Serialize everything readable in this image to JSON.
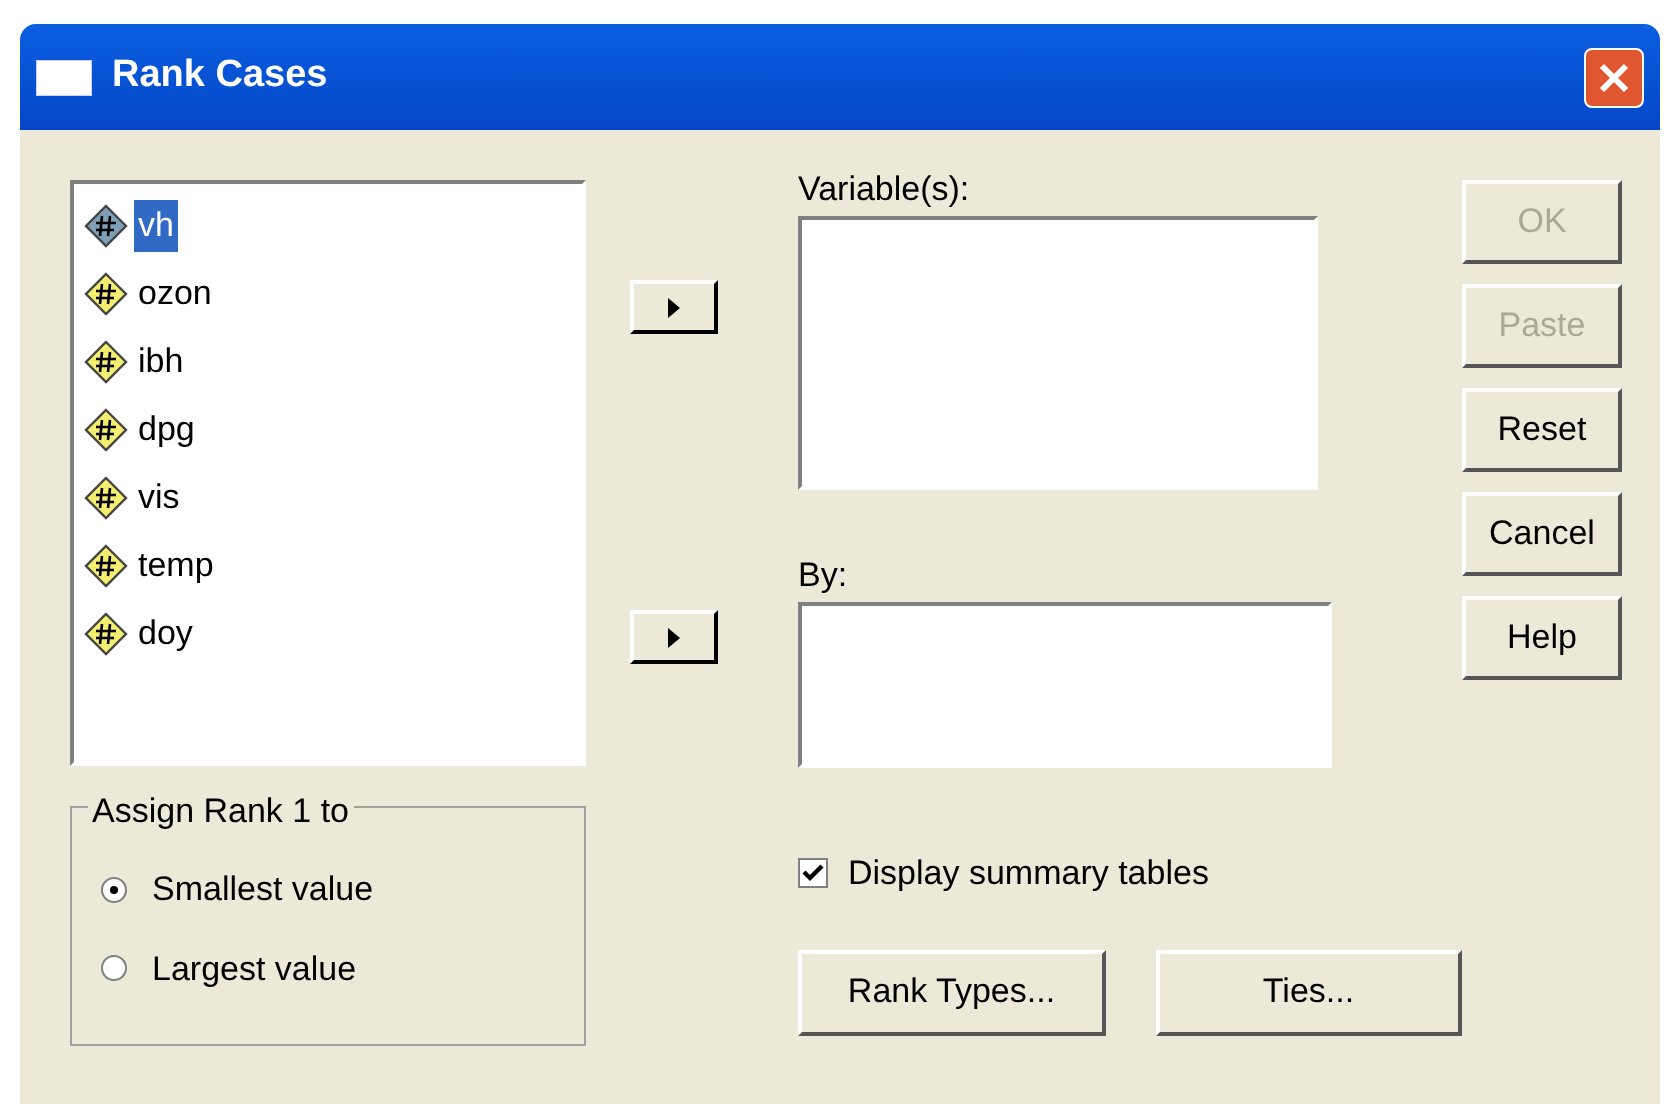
{
  "window": {
    "title": "Rank Cases"
  },
  "variables": [
    {
      "name": "vh",
      "selected": true
    },
    {
      "name": "ozon",
      "selected": false
    },
    {
      "name": "ibh",
      "selected": false
    },
    {
      "name": "dpg",
      "selected": false
    },
    {
      "name": "vis",
      "selected": false
    },
    {
      "name": "temp",
      "selected": false
    },
    {
      "name": "doy",
      "selected": false
    }
  ],
  "targets": [
    {
      "label": "Variable(s):"
    },
    {
      "label": "By:"
    }
  ],
  "side_buttons": [
    {
      "label": "OK",
      "disabled": true
    },
    {
      "label": "Paste",
      "disabled": true
    },
    {
      "label": "Reset",
      "disabled": false
    },
    {
      "label": "Cancel",
      "disabled": false
    },
    {
      "label": "Help",
      "disabled": false
    }
  ],
  "assign_rank": {
    "title": "Assign Rank 1 to",
    "options": [
      {
        "label": "Smallest value",
        "selected": true
      },
      {
        "label": "Largest value",
        "selected": false
      }
    ]
  },
  "summary": {
    "label": "Display summary tables",
    "checked": true
  },
  "bottom_buttons": [
    {
      "label": "Rank Types..."
    },
    {
      "label": "Ties..."
    }
  ]
}
